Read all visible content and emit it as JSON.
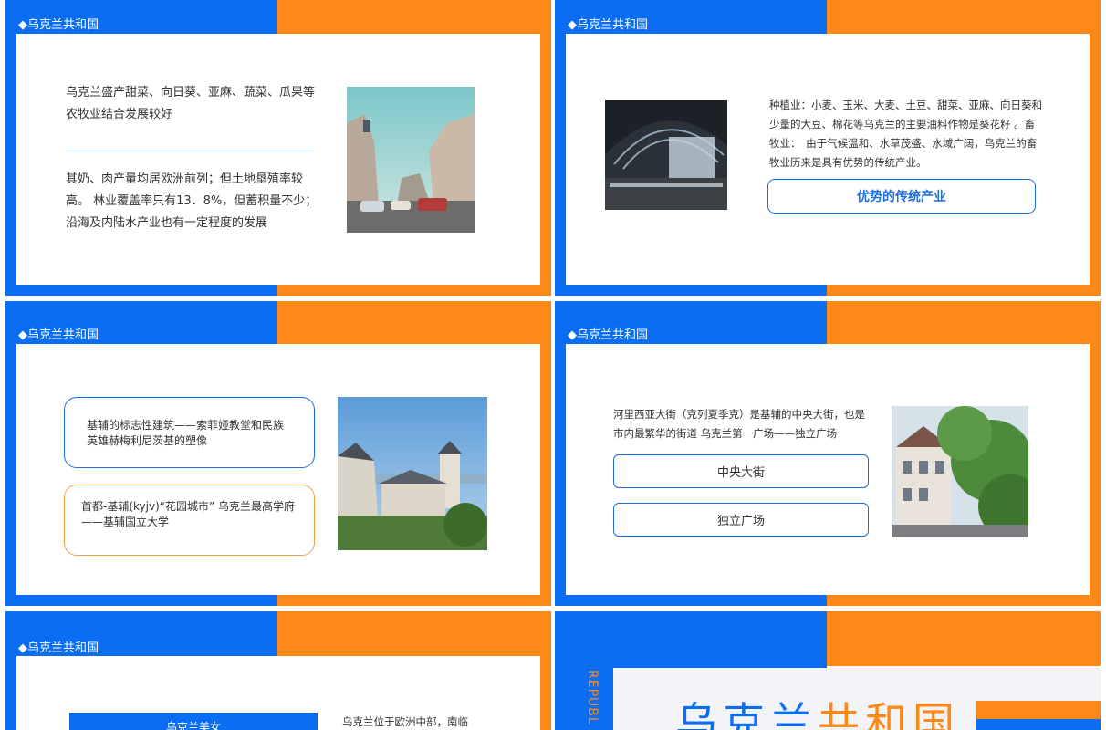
{
  "slides": {
    "header": "◆乌克兰共和国",
    "s1": {
      "para1": "乌克兰盛产甜菜、向日葵、亚麻、蔬菜、瓜果等 农牧业结合发展较好",
      "para2": "其奶、肉产量均居欧洲前列；但土地垦殖率较高。 林业覆盖率只有13．8%，但蓄积量不少；沿海及内陆水产业也有一定程度的发展"
    },
    "s2": {
      "para": "种植业：小麦、玉米、大麦、土豆、甜菜、亚麻、向日葵和少量的大豆、棉花等乌克兰的主要油料作物是葵花籽 。畜牧业：　由于气候温和、水草茂盛、水域广阔，乌克兰的畜牧业历来是具有优势的传统产业。",
      "button": "优势的传统产业"
    },
    "s3": {
      "box1": "基辅的标志性建筑——索菲娅教堂和民族英雄赫梅利尼茨基的塑像",
      "box2": "首都-基辅(kyjv)“花园城市” 乌克兰最高学府——基辅国立大学"
    },
    "s4": {
      "para": "河里西亚大街（克列夏季克）是基辅的中央大街，也是市内最繁华的街道 乌克兰第一广场——独立广场",
      "btn1": "中央大街",
      "btn2": "独立广场"
    },
    "s5": {
      "banner": "乌克兰美女",
      "para": "乌克兰位于欧洲中部，南临"
    },
    "s6": {
      "vertical": "REPUBL",
      "title_a": "乌克兰",
      "title_b": "共和国"
    }
  },
  "colors": {
    "blue": "#0b6ef2",
    "orange": "#fb8817",
    "text": "#333333"
  }
}
